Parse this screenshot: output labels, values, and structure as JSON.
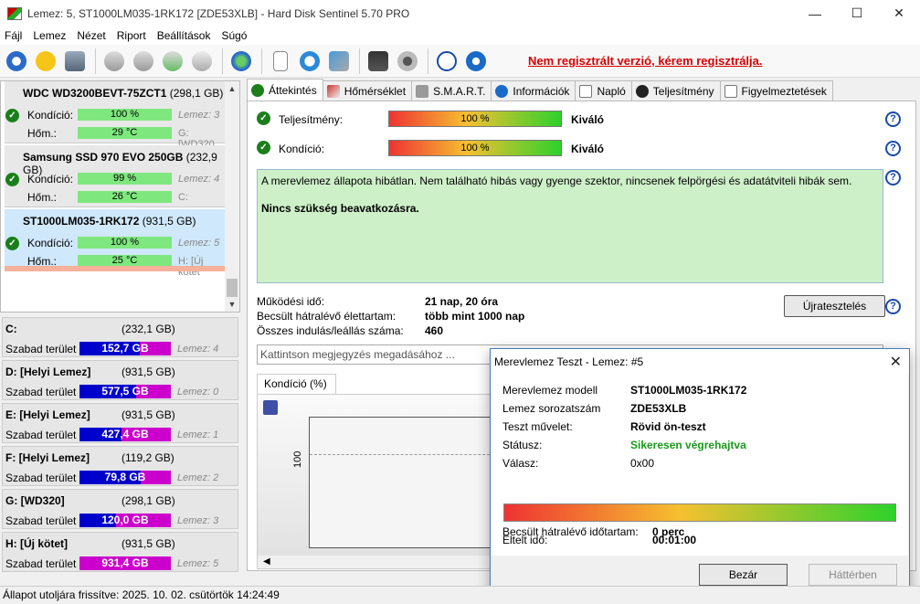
{
  "window": {
    "title": "Lemez: 5, ST1000LM035-1RK172 [ZDE53XLB]  -  Hard Disk Sentinel 5.70 PRO",
    "controls": {
      "minimize": "—",
      "maximize": "☐",
      "close": "✕"
    }
  },
  "menu": [
    "Fájl",
    "Lemez",
    "Nézet",
    "Riport",
    "Beállítások",
    "Súgó"
  ],
  "toolbar": {
    "register_link": "Nem regisztrált verzió, kérem regisztrálja."
  },
  "disks": [
    {
      "name": "WDC WD3200BEVT-75ZCT1",
      "size": "(298,1 GB)",
      "condition_label": "Kondíció:",
      "condition": "100 %",
      "condition_pct": 100,
      "temp_label": "Hőm.:",
      "temp": "29 °C",
      "side1": "Lemez: 3",
      "side2": "G: [WD320"
    },
    {
      "name": "Samsung SSD 970 EVO 250GB",
      "size": "(232,9 GB)",
      "condition_label": "Kondíció:",
      "condition": "99 %",
      "condition_pct": 99,
      "temp_label": "Hőm.:",
      "temp": "26 °C",
      "side1": "Lemez: 4",
      "side2": "C:"
    },
    {
      "name": "ST1000LM035-1RK172",
      "size": "(931,5 GB)",
      "condition_label": "Kondíció:",
      "condition": "100 %",
      "condition_pct": 100,
      "temp_label": "Hőm.:",
      "temp": "25 °C",
      "side1": "Lemez: 5",
      "side2": "H: [Új kötet"
    }
  ],
  "partitions": [
    {
      "name": "C:",
      "size": "(232,1 GB)",
      "free_label": "Szabad terület",
      "free": "152,7 GB",
      "free_fraction": 0.66,
      "disk": "Lemez: 4"
    },
    {
      "name": "D: [Helyi Lemez]",
      "size": "(931,5 GB)",
      "free_label": "Szabad terület",
      "free": "577,5 GB",
      "free_fraction": 0.62,
      "disk": "Lemez: 0"
    },
    {
      "name": "E: [Helyi Lemez]",
      "size": "(931,5 GB)",
      "free_label": "Szabad terület",
      "free": "427,4 GB",
      "free_fraction": 0.46,
      "disk": "Lemez: 1"
    },
    {
      "name": "F: [Helyi Lemez]",
      "size": "(119,2 GB)",
      "free_label": "Szabad terület",
      "free": "79,8 GB",
      "free_fraction": 0.67,
      "disk": "Lemez: 2"
    },
    {
      "name": "G: [WD320]",
      "size": "(298,1 GB)",
      "free_label": "Szabad terület",
      "free": "120,0 GB",
      "free_fraction": 0.4,
      "disk": "Lemez: 3"
    },
    {
      "name": "H: [Új kötet]",
      "size": "(931,5 GB)",
      "free_label": "Szabad terület",
      "free": "931,4 GB",
      "free_fraction": 0.0,
      "disk": "Lemez: 5"
    }
  ],
  "tabs": [
    "Áttekintés",
    "Hőmérséklet",
    "S.M.A.R.T.",
    "Információk",
    "Napló",
    "Teljesítmény",
    "Figyelmeztetések"
  ],
  "overview": {
    "performance_label": "Teljesítmény:",
    "performance_value": "100 %",
    "performance_rating": "Kiváló",
    "condition_label": "Kondíció:",
    "condition_value": "100 %",
    "condition_rating": "Kiváló",
    "message": "A merevlemez állapota hibátlan. Nem található hibás vagy gyenge szektor, nincsenek felpörgési és adatátviteli hibák sem.",
    "recommendation": "Nincs szükség beavatkozásra.",
    "uptime_label": "Működési idő:",
    "uptime": "21 nap, 20 óra",
    "remaining_label": "Becsült hátralévő élettartam:",
    "remaining": "több mint 1000 nap",
    "starts_label": "Összes indulás/leállás száma:",
    "starts": "460",
    "retest_button": "Újratesztelés",
    "comment_placeholder": "Kattintson megjegyzés megadásához ...",
    "chart_tab": "Kondíció  (%)",
    "chart_y_tick": "100",
    "help": "?"
  },
  "dialog": {
    "title": "Merevlemez Teszt - Lemez: #5",
    "model_label": "Merevlemez modell",
    "model": "ST1000LM035-1RK172",
    "serial_label": "Lemez sorozatszám",
    "serial": "ZDE53XLB",
    "operation_label": "Teszt művelet:",
    "operation": "Rövid ön-teszt",
    "status_label": "Státusz:",
    "status": "Sikeresen végrehajtva",
    "response_label": "Válasz:",
    "response": "0x00",
    "progress": 1.0,
    "elapsed_label": "Eltelt idő:",
    "elapsed": "00:01:00",
    "remaining_label": "Becsült hátralévő időtartam:",
    "remaining": "0 perc",
    "close_button": "Bezár",
    "background_button": "Háttérben"
  },
  "statusbar": {
    "text": "Állapot utoljára frissítve: 2025. 10. 02. csütörtök 14:24:49"
  },
  "colors": {
    "accent_link": "#d60000",
    "ok_green": "#1a7f1a",
    "status_green": "#1a9a1a",
    "free_blue": "#0000cc",
    "used_magenta": "#cc00cc",
    "overview_bg": "#cdf0c8"
  }
}
